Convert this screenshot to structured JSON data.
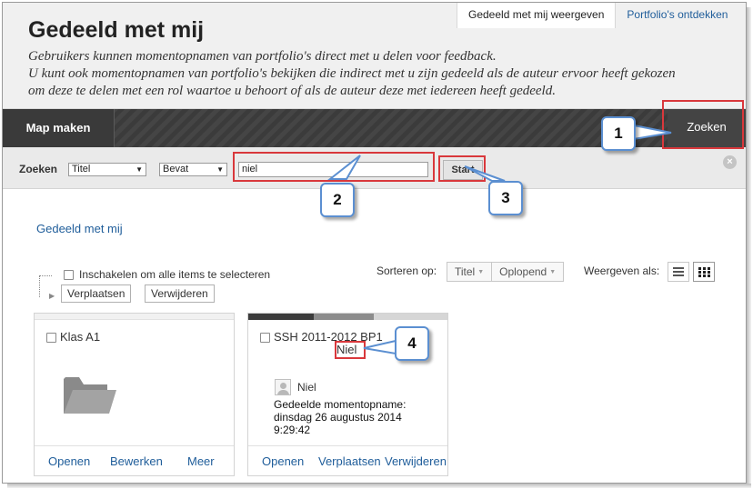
{
  "header": {
    "title": "Gedeeld met mij",
    "description": [
      "Gebruikers kunnen momentopnamen van portfolio's direct met u delen voor feedback.",
      "U kunt ook momentopnamen van portfolio's bekijken die indirect met u zijn gedeeld als de auteur ervoor heeft gekozen",
      "om deze te delen met een rol waartoe u behoort of als de auteur deze met iedereen heeft gedeeld."
    ],
    "tabs": [
      {
        "label": "Gedeeld met mij weergeven",
        "active": true
      },
      {
        "label": "Portfolio's ontdekken",
        "active": false
      }
    ]
  },
  "toolbar": {
    "create_folder_label": "Map maken",
    "search_label": "Zoeken"
  },
  "search": {
    "label": "Zoeken",
    "field_select": "Titel",
    "operator_select": "Bevat",
    "query_value": "niel",
    "start_label": "Start",
    "close_icon": "close-circle-icon"
  },
  "breadcrumb": "Gedeeld met mij",
  "bulk": {
    "select_all_label": "Inschakelen om alle items te selecteren",
    "move_label": "Verplaatsen",
    "delete_label": "Verwijderen"
  },
  "sort": {
    "label": "Sorteren op:",
    "options": [
      "Titel",
      "Oplopend"
    ]
  },
  "view": {
    "label": "Weergeven als:",
    "modes": [
      "list-icon",
      "grid-icon"
    ],
    "active_mode": "grid"
  },
  "cards": [
    {
      "title": "Klas A1",
      "icon": "folder-icon",
      "actions": [
        "Openen",
        "Bewerken",
        "Meer"
      ]
    },
    {
      "title": "SSH 2011-2012 BP1",
      "owner": "Niel",
      "shared_by": "Niel",
      "shared_line1": "Gedeelde momentopname:",
      "shared_line2": "dinsdag 26 augustus 2014",
      "shared_line3": "9:29:42",
      "actions": [
        "Openen",
        "Verplaatsen",
        "Verwijderen"
      ]
    }
  ],
  "callouts": [
    "1",
    "2",
    "3",
    "4"
  ],
  "colors": {
    "link": "#1f5d9a",
    "highlight": "#d9383c",
    "callout_border": "#5b8fd1",
    "toolbar": "#3b3b3b"
  }
}
